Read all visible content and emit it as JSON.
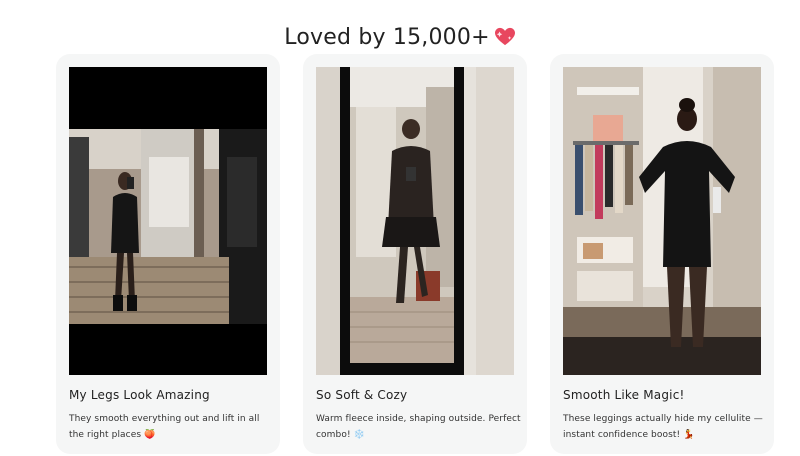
{
  "section": {
    "title": "Loved by 15,000+",
    "title_icon": "sparkling-heart-icon"
  },
  "reviews": [
    {
      "title": "My Legs Look Amazing",
      "text": "They smooth everything out and lift in all the right places",
      "emoji": "🍑",
      "photo": "mirror-selfie-photo"
    },
    {
      "title": "So Soft & Cozy",
      "text": "Warm fleece inside, shaping outside. Perfect combo!",
      "emoji": "❄️",
      "photo": "mirror-selfie-photo"
    },
    {
      "title": "Smooth Like Magic!",
      "text": "These leggings actually hide my cellulite — instant confidence boost!",
      "emoji": "💃",
      "photo": "closet-photo"
    }
  ],
  "colors": {
    "card_bg": "#f5f6f6",
    "heart": "#e8475f"
  }
}
